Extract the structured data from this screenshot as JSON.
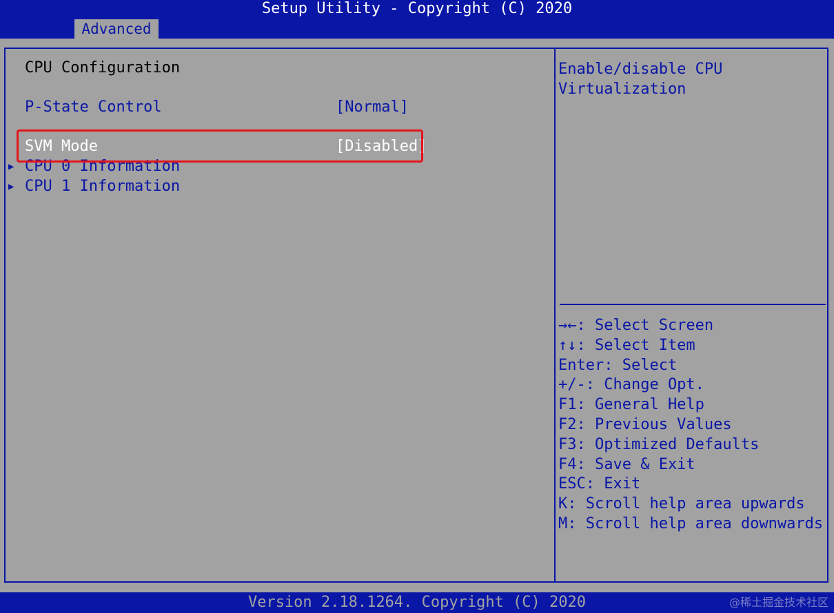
{
  "header": {
    "title": "Setup Utility - Copyright (C) 2020",
    "active_tab": "Advanced"
  },
  "main": {
    "section_title": "CPU Configuration",
    "items": [
      {
        "label": "P-State Control",
        "value": "[Normal]",
        "selected": false
      },
      {
        "label": "SVM Mode",
        "value": "[Disabled]",
        "selected": true
      }
    ],
    "submenus": [
      {
        "label": "CPU 0 Information",
        "icon": "triangle-right-icon"
      },
      {
        "label": "CPU 1 Information",
        "icon": "triangle-right-icon"
      }
    ]
  },
  "help": {
    "description": "Enable/disable CPU\nVirtualization",
    "keys": [
      "→←: Select Screen",
      "↑↓: Select Item",
      "Enter: Select",
      "+/-: Change Opt.",
      "F1: General Help",
      "F2: Previous Values",
      "F3: Optimized Defaults",
      "F4: Save & Exit",
      "ESC: Exit",
      "K: Scroll help area upwards",
      "M: Scroll help area downwards"
    ]
  },
  "footer": {
    "version": "Version 2.18.1264. Copyright (C) 2020"
  },
  "watermark": "@稀土掘金技术社区",
  "colors": {
    "bios_blue": "#0a16a6",
    "bios_gray": "#a2a2a2",
    "highlight_red": "#e4141b",
    "selected_text": "#ffffff"
  }
}
